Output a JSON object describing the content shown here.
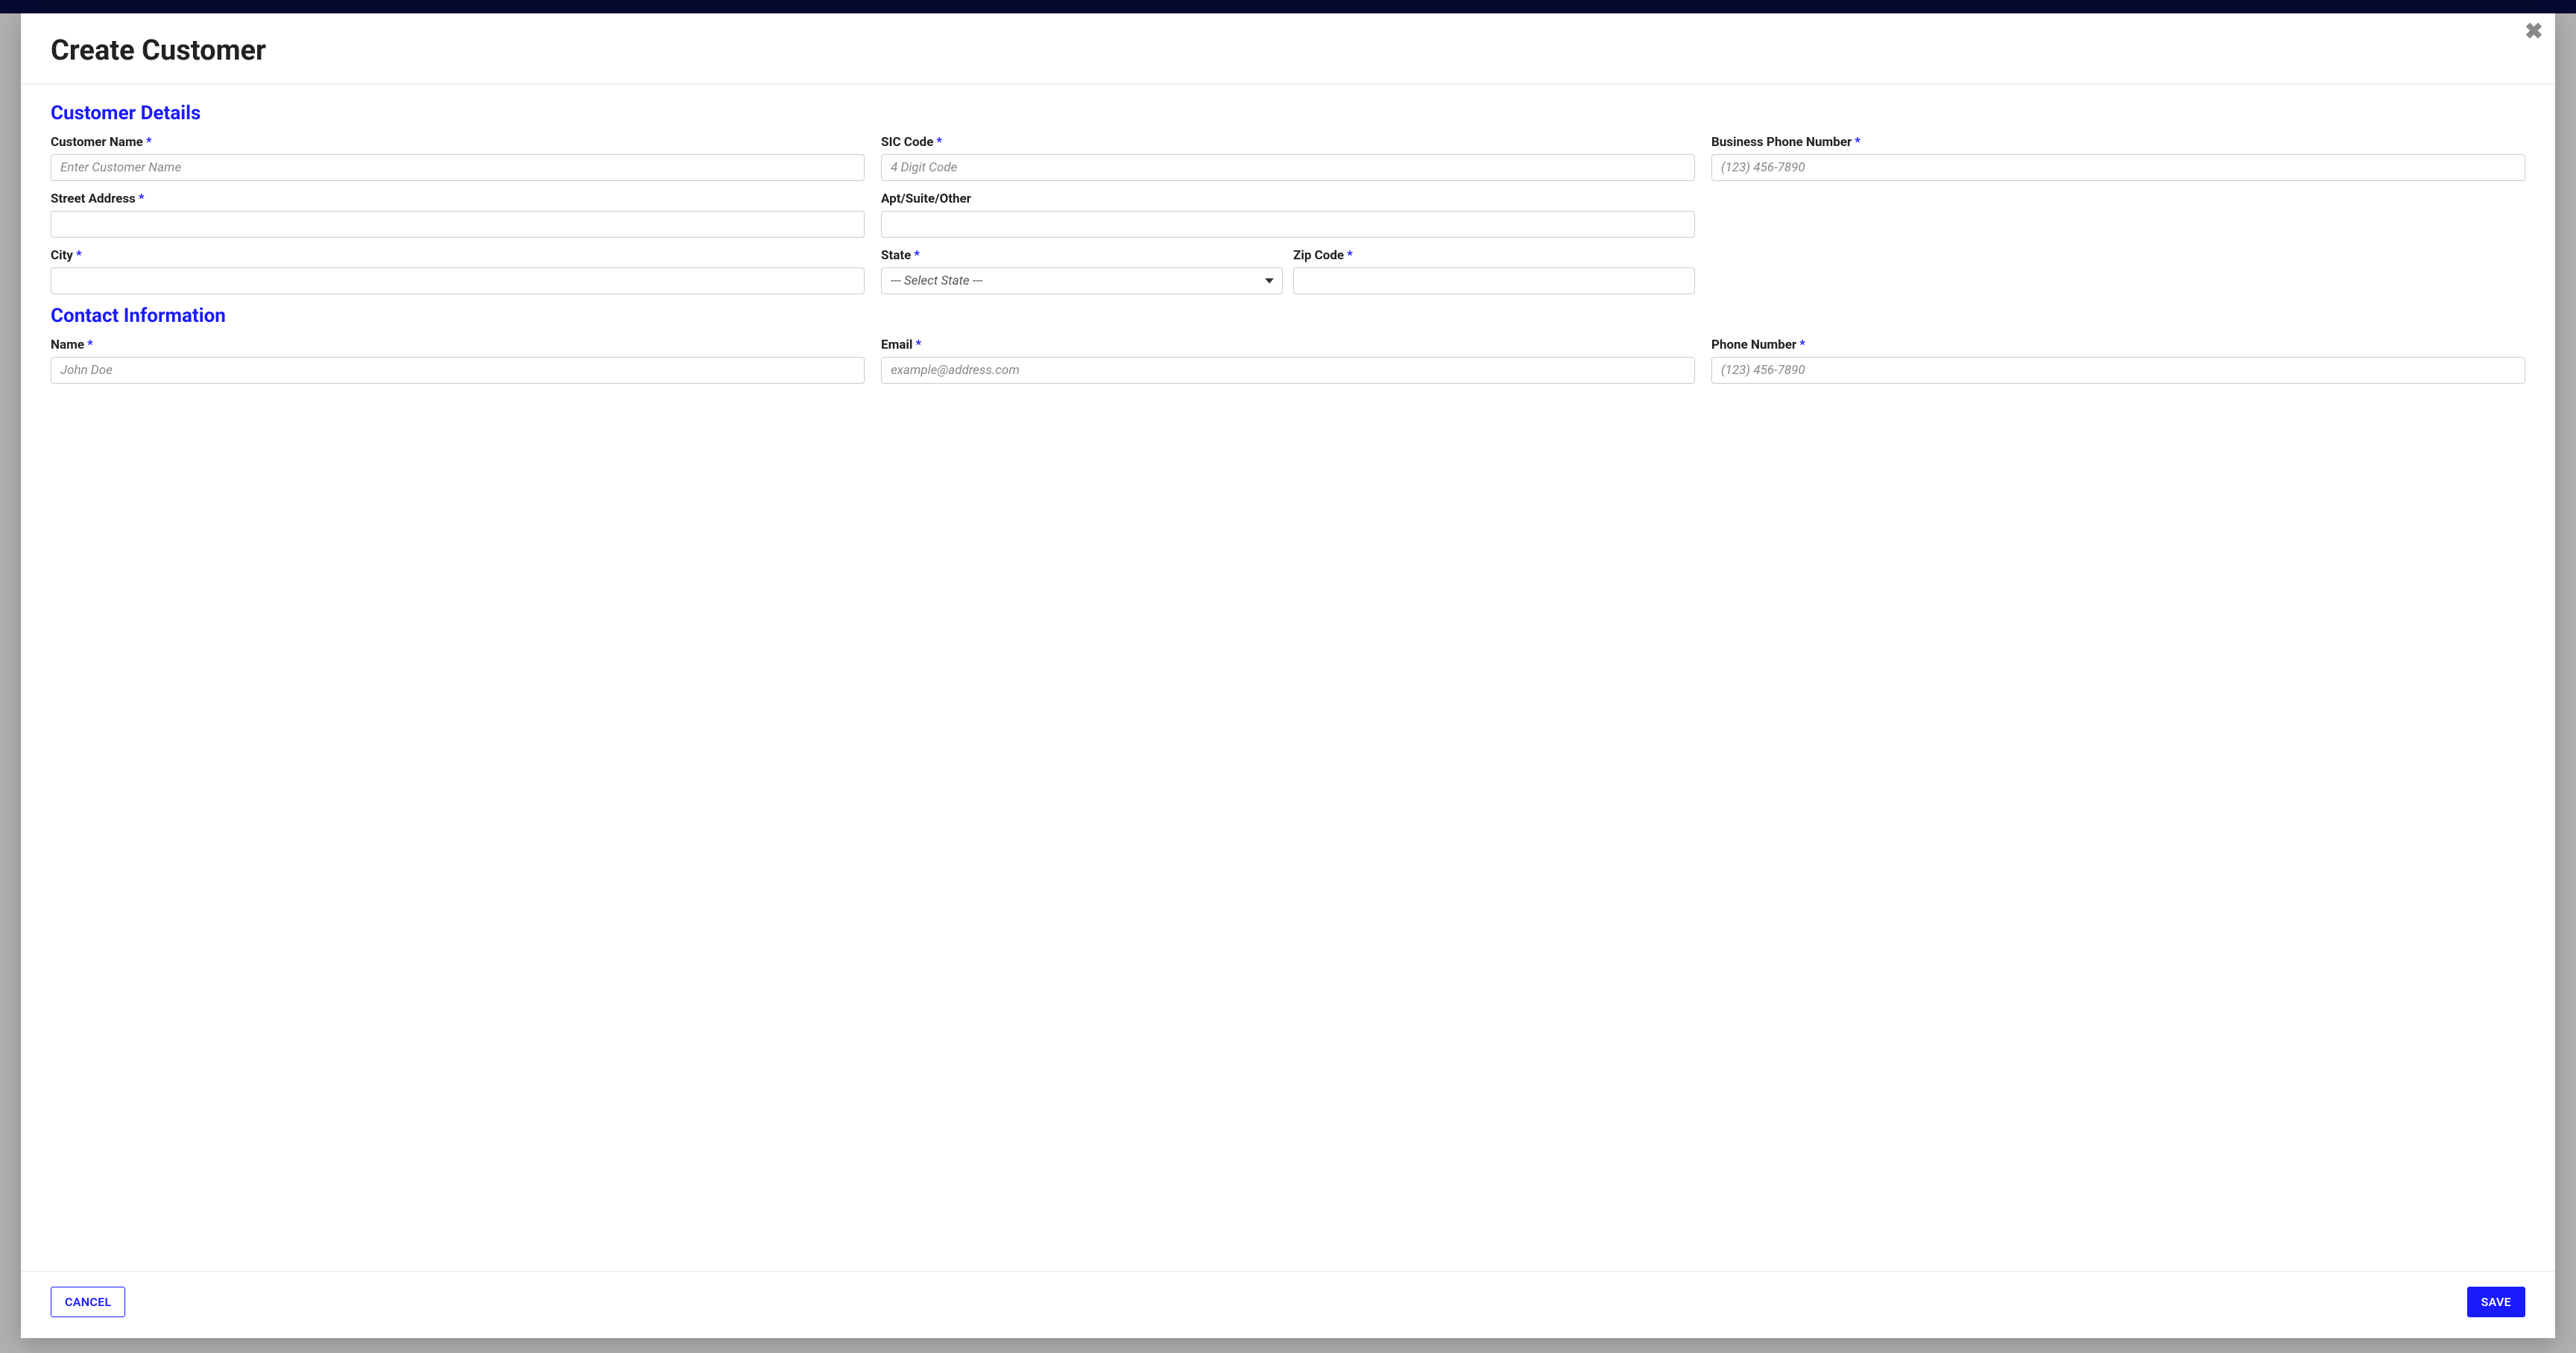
{
  "modal": {
    "title": "Create Customer",
    "close_label": "✖"
  },
  "sections": {
    "customer_details": {
      "title": "Customer Details",
      "fields": {
        "customer_name": {
          "label": "Customer Name",
          "required": true,
          "placeholder": "Enter Customer Name",
          "value": ""
        },
        "sic_code": {
          "label": "SIC Code",
          "required": true,
          "placeholder": "4 Digit Code",
          "value": ""
        },
        "business_phone": {
          "label": "Business Phone Number",
          "required": true,
          "placeholder": "(123) 456-7890",
          "value": ""
        },
        "street_address": {
          "label": "Street Address",
          "required": true,
          "placeholder": "",
          "value": ""
        },
        "apt_suite": {
          "label": "Apt/Suite/Other",
          "required": false,
          "placeholder": "",
          "value": ""
        },
        "city": {
          "label": "City",
          "required": true,
          "placeholder": "",
          "value": ""
        },
        "state": {
          "label": "State",
          "required": true,
          "selected": "--- Select State ---"
        },
        "zip": {
          "label": "Zip Code",
          "required": true,
          "placeholder": "",
          "value": ""
        }
      }
    },
    "contact_info": {
      "title": "Contact Information",
      "fields": {
        "name": {
          "label": "Name",
          "required": true,
          "placeholder": "John Doe",
          "value": ""
        },
        "email": {
          "label": "Email",
          "required": true,
          "placeholder": "example@address.com",
          "value": ""
        },
        "phone": {
          "label": "Phone Number",
          "required": true,
          "placeholder": "(123) 456-7890",
          "value": ""
        }
      }
    }
  },
  "footer": {
    "cancel": "CANCEL",
    "save": "SAVE"
  },
  "required_marker": "*"
}
